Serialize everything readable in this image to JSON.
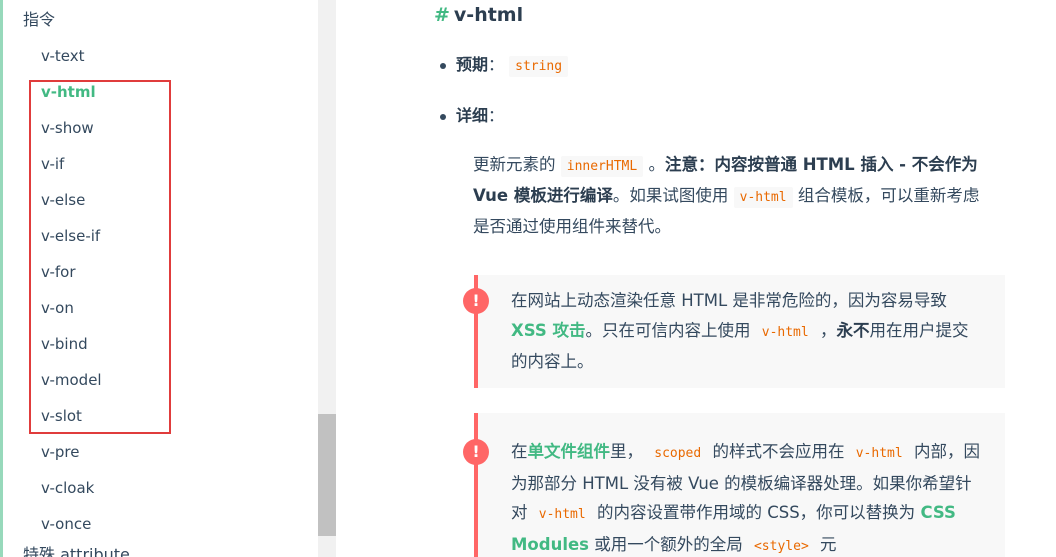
{
  "sidebar": {
    "group_title": "指令",
    "items": [
      {
        "label": "v-text"
      },
      {
        "label": "v-html"
      },
      {
        "label": "v-show"
      },
      {
        "label": "v-if"
      },
      {
        "label": "v-else"
      },
      {
        "label": "v-else-if"
      },
      {
        "label": "v-for"
      },
      {
        "label": "v-on"
      },
      {
        "label": "v-bind"
      },
      {
        "label": "v-model"
      },
      {
        "label": "v-slot"
      },
      {
        "label": "v-pre"
      },
      {
        "label": "v-cloak"
      },
      {
        "label": "v-once"
      }
    ],
    "active_item": "v-html",
    "next_group_title": "特殊 attribute"
  },
  "content": {
    "heading_hash": "#",
    "heading": "v-html",
    "expect_label": "预期",
    "expect_colon": "：",
    "expect_value": "string",
    "detail_label": "详细",
    "detail_colon": "：",
    "para": {
      "t1": "更新元素的",
      "c1": "innerHTML",
      "t2": "。",
      "b1": "注意：内容按普通 HTML 插入 - 不会作为 Vue 模板进行编译",
      "t3": "。如果试图使用",
      "c2": "v-html",
      "t4": "组合模板，可以重新考虑是否通过使用组件来替代。"
    },
    "callout1": {
      "icon": "!",
      "t1": "在网站上动态渲染任意 HTML 是非常危险的，因为容易导致",
      "link": "XSS 攻击",
      "t2": "。只在可信内容上使用",
      "c1": "v-html",
      "t3": "，",
      "b1": "永不",
      "t4": "用在用户提交的内容上。"
    },
    "callout2": {
      "icon": "!",
      "t1": "在",
      "link1": "单文件组件",
      "t2": "里，",
      "c1": "scoped",
      "t3": "的样式不会应用在",
      "c2": "v-html",
      "t4": "内部，因为那部分 HTML 没有被 Vue 的模板编译器处理。如果你希望针对",
      "c3": "v-html",
      "t5": "的内容设置带作用域的 CSS，你可以替换为",
      "link2": "CSS Modules",
      "t6": "或用一个额外的全局",
      "c4": "<style>",
      "t7": "元"
    }
  },
  "colors": {
    "accent": "#42b983",
    "text": "#34495e",
    "code": "#e96900",
    "warning": "#ff6666",
    "highlight_box": "#e03c3c"
  }
}
